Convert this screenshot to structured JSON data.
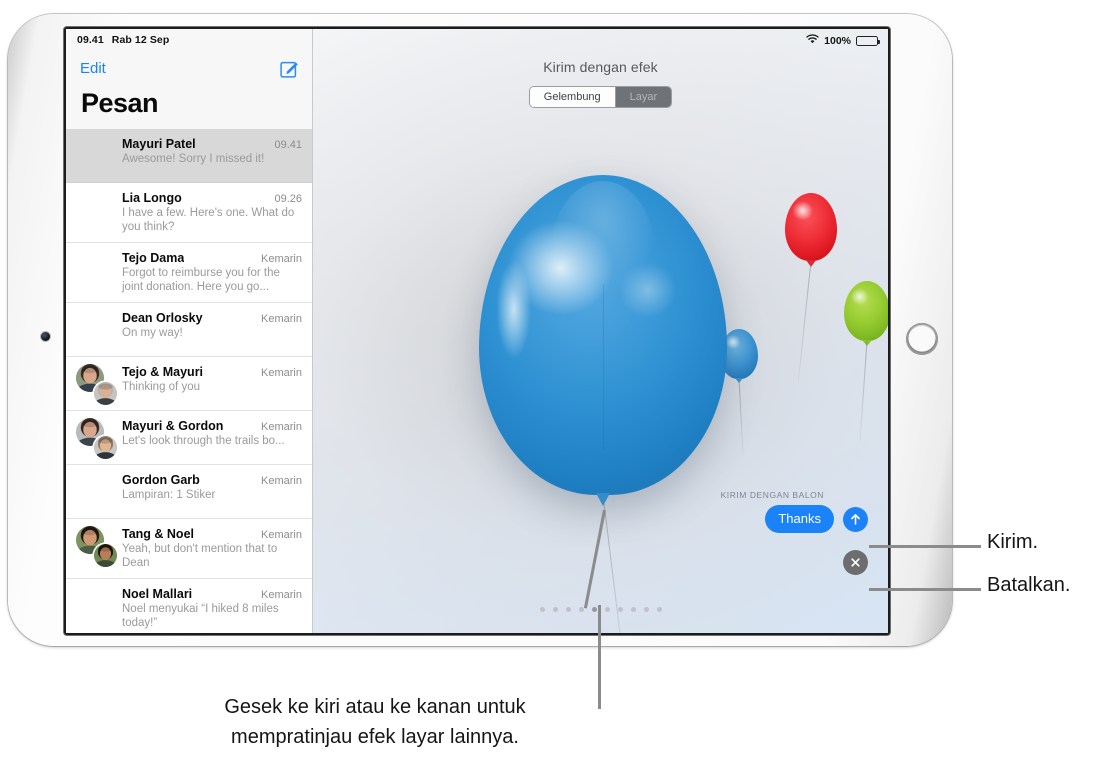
{
  "device": {
    "kind": "ipad-landscape",
    "camera": "front-camera",
    "home_button": "home-button"
  },
  "status_bar": {
    "time": "09.41",
    "date": "Rab 12 Sep",
    "wifi_icon": "wifi-icon",
    "battery_percent": "100%",
    "battery_icon": "battery-icon"
  },
  "sidebar": {
    "edit_label": "Edit",
    "compose_icon": "compose-pencil-icon",
    "title": "Pesan",
    "conversations": [
      {
        "name": "Mayuri Patel",
        "time": "09.41",
        "preview": "Awesome! Sorry I missed it!",
        "selected": true,
        "avatar": "single"
      },
      {
        "name": "Lia Longo",
        "time": "09.26",
        "preview": "I have a few. Here's one. What do you think?",
        "selected": false,
        "avatar": "single"
      },
      {
        "name": "Tejo Dama",
        "time": "Kemarin",
        "preview": "Forgot to reimburse you for the joint donation. Here you go...",
        "selected": false,
        "avatar": "single"
      },
      {
        "name": "Dean Orlosky",
        "time": "Kemarin",
        "preview": "On my way!",
        "selected": false,
        "avatar": "single"
      },
      {
        "name": "Tejo & Mayuri",
        "time": "Kemarin",
        "preview": "Thinking of you",
        "selected": false,
        "avatar": "group"
      },
      {
        "name": "Mayuri & Gordon",
        "time": "Kemarin",
        "preview": "Let's look through the trails bo...",
        "selected": false,
        "avatar": "group"
      },
      {
        "name": "Gordon Garb",
        "time": "Kemarin",
        "preview": "Lampiran: 1 Stiker",
        "selected": false,
        "avatar": "single"
      },
      {
        "name": "Tang & Noel",
        "time": "Kemarin",
        "preview": "Yeah, but don't mention that to Dean",
        "selected": false,
        "avatar": "group"
      },
      {
        "name": "Noel Mallari",
        "time": "Kemarin",
        "preview": "Noel menyukai “I hiked 8 miles today!”",
        "selected": false,
        "avatar": "single"
      }
    ]
  },
  "effect_panel": {
    "title": "Kirim dengan efek",
    "segments": [
      {
        "label": "Gelembung",
        "active": false
      },
      {
        "label": "Layar",
        "active": true
      }
    ],
    "effect_name": "KIRIM DENGAN BALON",
    "message_text": "Thanks",
    "send_icon": "arrow-up-icon",
    "cancel_icon": "close-x-icon",
    "page_dots": {
      "count": 10,
      "active_index": 4
    },
    "balloons": [
      {
        "name": "large-blue-balloon",
        "color": "#2f92d3"
      },
      {
        "name": "red-balloon",
        "color": "#ef2d36"
      },
      {
        "name": "green-balloon",
        "color": "#96cc31"
      },
      {
        "name": "small-blue-balloon",
        "color": "#3d95d3"
      }
    ]
  },
  "annotations": {
    "send_callout": "Kirim.",
    "cancel_callout": "Batalkan.",
    "bottom_caption_line1": "Gesek ke kiri atau ke kanan untuk",
    "bottom_caption_line2": "mempratinjau efek layar lainnya."
  },
  "colors": {
    "accent_blue": "#1b82f7",
    "selected_row": "#d8d8d8",
    "segment_active": "#6f7276",
    "callout_gray": "#8b8b8b"
  }
}
